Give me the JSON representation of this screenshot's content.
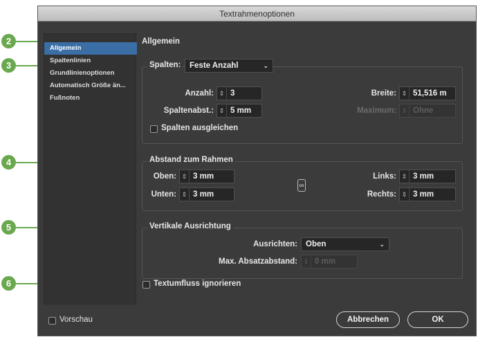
{
  "window": {
    "title": "Textrahmenoptionen"
  },
  "sidebar": {
    "items": [
      {
        "label": "Allgemein",
        "selected": true
      },
      {
        "label": "Spaltenlinien"
      },
      {
        "label": "Grundlinienoptionen"
      },
      {
        "label": "Automatisch Größe än..."
      },
      {
        "label": "Fußnoten"
      }
    ]
  },
  "main": {
    "title": "Allgemein",
    "columns": {
      "legend": "Spalten:",
      "type": "Feste Anzahl",
      "count_label": "Anzahl:",
      "count_value": "3",
      "width_label": "Breite:",
      "width_value": "51,516 m",
      "gutter_label": "Spaltenabst.:",
      "gutter_value": "5 mm",
      "max_label": "Maximum:",
      "max_value": "Ohne",
      "balance_label": "Spalten ausgleichen",
      "balance_checked": false
    },
    "inset": {
      "legend": "Abstand zum Rahmen",
      "top_label": "Oben:",
      "top_value": "3 mm",
      "bottom_label": "Unten:",
      "bottom_value": "3 mm",
      "left_label": "Links:",
      "left_value": "3 mm",
      "right_label": "Rechts:",
      "right_value": "3 mm"
    },
    "vertical": {
      "legend": "Vertikale Ausrichtung",
      "align_label": "Ausrichten:",
      "align_value": "Oben",
      "max_spacing_label": "Max. Absatzabstand:",
      "max_spacing_value": "0 mm"
    },
    "ignore_wrap": {
      "label": "Textumfluss ignorieren",
      "checked": false
    }
  },
  "footer": {
    "preview_label": "Vorschau",
    "preview_checked": false,
    "cancel_label": "Abbrechen",
    "ok_label": "OK"
  },
  "callouts": [
    "2",
    "3",
    "4",
    "5",
    "6"
  ],
  "colors": {
    "callout": "#6aa84f",
    "selection": "#3a6ea5",
    "dialog_bg": "#3b3b3b"
  }
}
